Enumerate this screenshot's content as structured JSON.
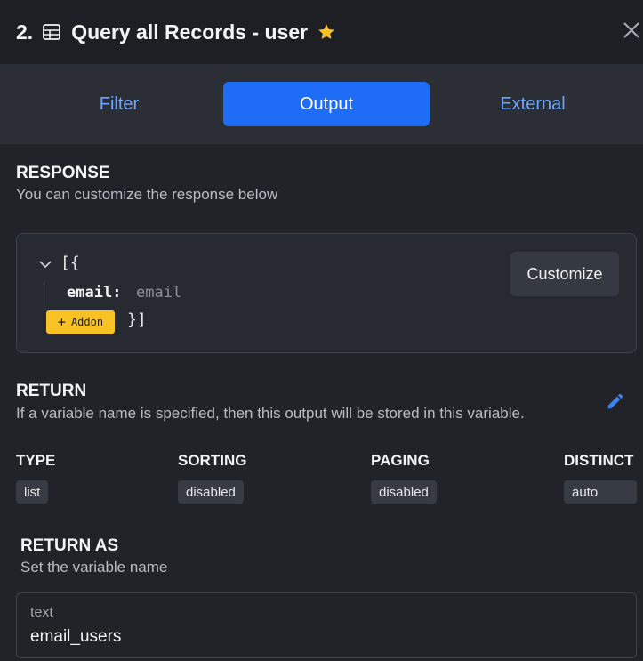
{
  "header": {
    "step": "2.",
    "title": "Query all Records - user",
    "icon_table": "table-icon",
    "icon_star": "star-icon",
    "icon_close": "close-icon",
    "star_color": "#f8c224"
  },
  "tabs": [
    {
      "label": "Filter",
      "active": false
    },
    {
      "label": "Output",
      "active": true
    },
    {
      "label": "External",
      "active": false
    }
  ],
  "response": {
    "title": "RESPONSE",
    "subtitle": "You can customize the response below",
    "code_open": "[{",
    "field_key": "email",
    "field_colon": ":",
    "field_value": "email",
    "addon_label": "Addon",
    "code_close": "}]",
    "customize_label": "Customize"
  },
  "return": {
    "title": "RETURN",
    "subtitle": "If a variable name is specified, then this output will be stored in this variable.",
    "edit_icon": "pencil-icon",
    "columns": [
      {
        "label": "TYPE",
        "value": "list"
      },
      {
        "label": "SORTING",
        "value": "disabled"
      },
      {
        "label": "PAGING",
        "value": "disabled"
      },
      {
        "label": "DISTINCT",
        "value": "auto"
      }
    ]
  },
  "return_as": {
    "title": "RETURN AS",
    "subtitle": "Set the variable name",
    "input_label": "text",
    "input_value": "email_users"
  },
  "colors": {
    "accent": "#1f6cf6",
    "tab_text": "#6aa6ff",
    "addon": "#f8c224"
  }
}
